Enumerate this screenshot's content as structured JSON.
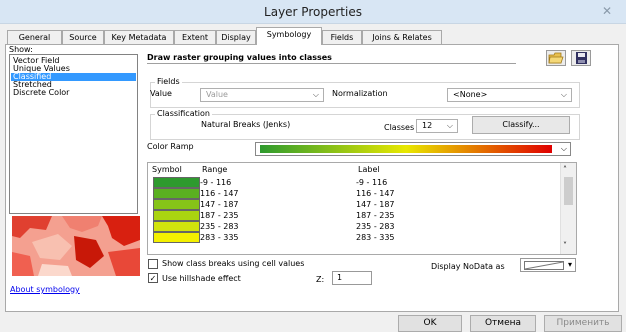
{
  "window": {
    "title": "Layer Properties",
    "close_glyph": "✕"
  },
  "tabs": [
    "General",
    "Source",
    "Key Metadata",
    "Extent",
    "Display",
    "Symbology",
    "Fields",
    "Joins & Relates"
  ],
  "show": {
    "label": "Show:",
    "items": [
      "Vector Field",
      "Unique Values",
      "Classified",
      "Stretched",
      "Discrete Color"
    ],
    "selected": "Classified"
  },
  "about_link": "About symbology",
  "heading": "Draw raster grouping values into classes",
  "fields": {
    "group_label": "Fields",
    "value_label": "Value",
    "value_select": "Value",
    "normalization_label": "Normalization",
    "normalization_select": "<None>"
  },
  "classification": {
    "group_label": "Classification",
    "method": "Natural Breaks (Jenks)",
    "classes_label": "Classes",
    "classes_value": "12",
    "classify_button": "Classify..."
  },
  "color_ramp_label": "Color Ramp",
  "table": {
    "headers": {
      "symbol": "Symbol",
      "range": "Range",
      "label": "Label"
    },
    "rows": [
      {
        "color": "#2e9a2e",
        "range": "-9 - 116",
        "label": "-9 - 116"
      },
      {
        "color": "#5ab020",
        "range": "116 - 147",
        "label": "116 - 147"
      },
      {
        "color": "#86c418",
        "range": "147 - 187",
        "label": "147 - 187"
      },
      {
        "color": "#aad410",
        "range": "187 - 235",
        "label": "187 - 235"
      },
      {
        "color": "#d2e40c",
        "range": "235 - 283",
        "label": "235 - 283"
      },
      {
        "color": "#f4f000",
        "range": "283 - 335",
        "label": "283 - 335"
      }
    ]
  },
  "options": {
    "class_breaks_label": "Show class breaks using cell values",
    "class_breaks_checked": false,
    "hillshade_label": "Use hillshade effect",
    "hillshade_checked": true,
    "z_label": "Z:",
    "z_value": "1",
    "nodata_label": "Display NoData as"
  },
  "buttons": {
    "ok": "OK",
    "cancel": "Отмена",
    "apply": "Применить"
  },
  "colors": {
    "selection": "#3399ff",
    "ramp_start": "#2e9a2e",
    "ramp_mid": "#e8e800",
    "ramp_end": "#e00000"
  },
  "icons": {
    "open": "folder-icon",
    "save": "save-icon"
  }
}
